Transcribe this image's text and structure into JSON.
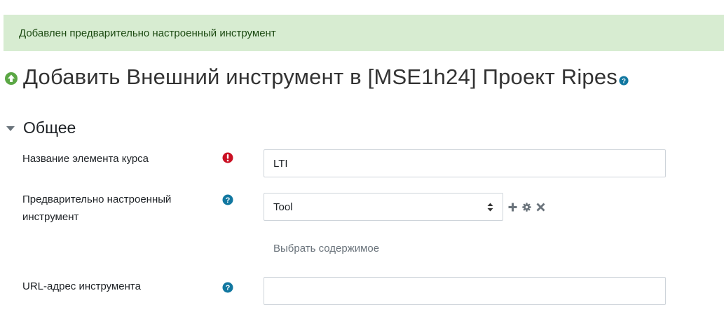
{
  "alert": {
    "message": "Добавлен предварительно настроенный инструмент"
  },
  "header": {
    "title": "Добавить Внешний инструмент в [MSE1h24] Проект Ripes",
    "icon": "upload-arrow-icon",
    "help_icon": "help-icon"
  },
  "section": {
    "title": "Общее",
    "toggle_icon": "chevron-down-icon"
  },
  "fields": {
    "activity_name": {
      "label": "Название элемента курса",
      "value": "LTI",
      "indicator": "required-icon"
    },
    "preconfigured_tool": {
      "label": "Предварительно настроенный инструмент",
      "selected": "Tool",
      "indicator": "help-icon",
      "actions": [
        "add-icon",
        "gear-icon",
        "close-icon"
      ]
    },
    "select_content": {
      "label": "Выбрать содержимое"
    },
    "tool_url": {
      "label": "URL-адрес инструмента",
      "value": "",
      "indicator": "help-icon"
    }
  },
  "colors": {
    "alert_bg": "#d7ecd1",
    "alert_text": "#1c4a12",
    "required": "#ca1023",
    "help": "#1177a0",
    "header_icon": "#5ba745"
  }
}
